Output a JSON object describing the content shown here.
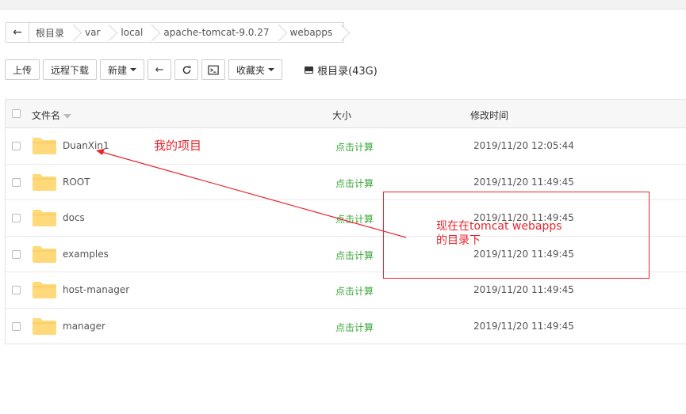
{
  "breadcrumb": {
    "items": [
      "根目录",
      "var",
      "local",
      "apache-tomcat-9.0.27",
      "webapps"
    ]
  },
  "toolbar": {
    "upload_label": "上传",
    "remote_download_label": "远程下载",
    "new_label": "新建",
    "favorites_label": "收藏夹",
    "disk_label": "根目录(43G)"
  },
  "table": {
    "headers": {
      "name": "文件名",
      "size": "大小",
      "modified": "修改时间"
    },
    "rows": [
      {
        "name": "DuanXin1",
        "size": "点击计算",
        "modified": "2019/11/20 12:05:44"
      },
      {
        "name": "ROOT",
        "size": "点击计算",
        "modified": "2019/11/20 11:49:45"
      },
      {
        "name": "docs",
        "size": "点击计算",
        "modified": "2019/11/20 11:49:45"
      },
      {
        "name": "examples",
        "size": "点击计算",
        "modified": "2019/11/20 11:49:45"
      },
      {
        "name": "host-manager",
        "size": "点击计算",
        "modified": "2019/11/20 11:49:45"
      },
      {
        "name": "manager",
        "size": "点击计算",
        "modified": "2019/11/20 11:49:45"
      }
    ]
  },
  "annotations": {
    "project_label": "我的项目",
    "note_prefix": "现在在",
    "note_highlight": "tomcat webapps",
    "note_suffix": "的目录下"
  },
  "colors": {
    "annotation": "#e8242c",
    "calc_link": "#3aa83a",
    "folder": "#ffd97a"
  }
}
